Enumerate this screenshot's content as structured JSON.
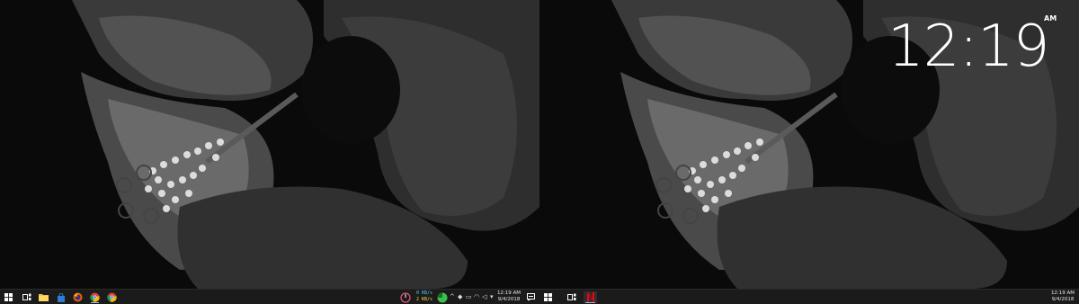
{
  "left_screen": {
    "taskbar": {
      "items": [
        {
          "name": "windows-start",
          "icon": "windows-logo-icon"
        },
        {
          "name": "task-view",
          "icon": "task-view-icon"
        },
        {
          "name": "file-explorer",
          "icon": "folder-icon"
        },
        {
          "name": "store",
          "icon": "store-bag-icon"
        },
        {
          "name": "firefox",
          "icon": "firefox-icon"
        },
        {
          "name": "chrome-1",
          "icon": "chrome-icon"
        },
        {
          "name": "chrome-2",
          "icon": "chrome-icon"
        }
      ],
      "net_speed": {
        "up": "0 KB/s",
        "down": "2 KB/s"
      },
      "clock": {
        "time": "12:19 AM",
        "date": "9/4/2018"
      },
      "colors": {
        "speed_up": "#55d0ff",
        "speed_down": "#ffd84a",
        "gauge_green": "#37c24a",
        "gauge_pink": "#e8557a"
      }
    }
  },
  "right_screen": {
    "big_clock": {
      "time": "12:19",
      "ampm": "AM"
    },
    "taskbar": {
      "items": [
        {
          "name": "windows-start",
          "icon": "windows-logo-icon"
        },
        {
          "name": "task-view",
          "icon": "task-view-icon"
        },
        {
          "name": "netflix",
          "icon": "netflix-icon"
        }
      ],
      "clock": {
        "time": "12:19 AM",
        "date": "9/4/2018"
      },
      "colors": {
        "netflix_red": "#e50914"
      }
    }
  },
  "wallpaper": {
    "subject": "monochrome hibiscus flower"
  }
}
